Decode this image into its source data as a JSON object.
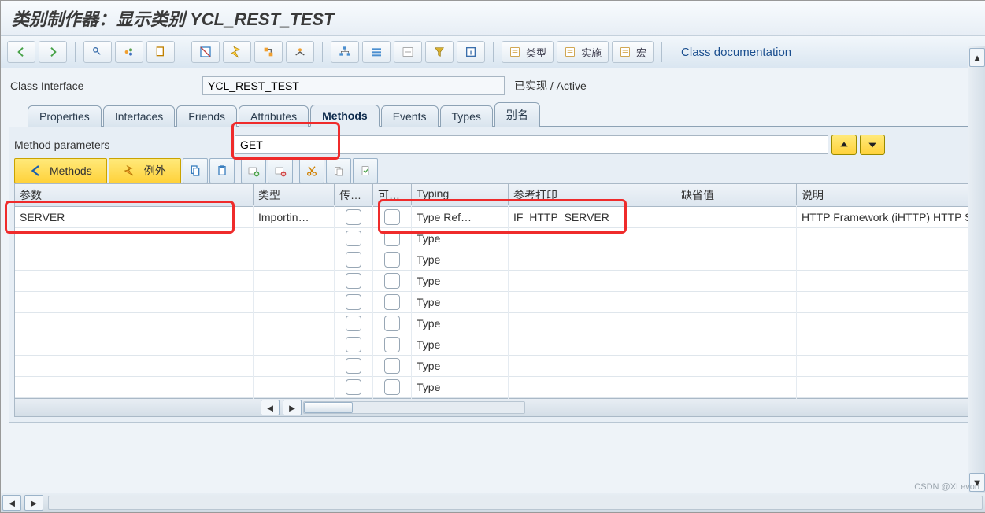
{
  "title_prefix": "类别制作器：显示类别 ",
  "title_class": "YCL_REST_TEST",
  "toolbar_text_buttons": {
    "types": "类型",
    "impl": "实施",
    "macro": "宏"
  },
  "class_doc_link": "Class documentation",
  "class_interface_label": "Class Interface",
  "class_interface_value": "YCL_REST_TEST",
  "status_text": "已实现 / Active",
  "tabs": [
    "Properties",
    "Interfaces",
    "Friends",
    "Attributes",
    "Methods",
    "Events",
    "Types",
    "别名"
  ],
  "active_tab_index": 4,
  "method_params_label": "Method parameters",
  "method_name": "GET",
  "btn_methods": "Methods",
  "btn_exceptions": "例外",
  "grid_headers": {
    "param": "参数",
    "kind": "类型",
    "pass": "传…",
    "opt": "可…",
    "typing": "Typing",
    "ref": "参考打印",
    "default": "缺省值",
    "desc": "说明"
  },
  "grid_rows": [
    {
      "param": "SERVER",
      "kind": "Importin…",
      "typing": "Type Ref…",
      "ref": "IF_HTTP_SERVER",
      "default": "",
      "desc": "HTTP Framework (iHTTP) HTTP Se"
    },
    {
      "param": "",
      "kind": "",
      "typing": "Type",
      "ref": "",
      "default": "",
      "desc": ""
    },
    {
      "param": "",
      "kind": "",
      "typing": "Type",
      "ref": "",
      "default": "",
      "desc": ""
    },
    {
      "param": "",
      "kind": "",
      "typing": "Type",
      "ref": "",
      "default": "",
      "desc": ""
    },
    {
      "param": "",
      "kind": "",
      "typing": "Type",
      "ref": "",
      "default": "",
      "desc": ""
    },
    {
      "param": "",
      "kind": "",
      "typing": "Type",
      "ref": "",
      "default": "",
      "desc": ""
    },
    {
      "param": "",
      "kind": "",
      "typing": "Type",
      "ref": "",
      "default": "",
      "desc": ""
    },
    {
      "param": "",
      "kind": "",
      "typing": "Type",
      "ref": "",
      "default": "",
      "desc": ""
    },
    {
      "param": "",
      "kind": "",
      "typing": "Type",
      "ref": "",
      "default": "",
      "desc": ""
    }
  ],
  "watermark": "CSDN @XLevon"
}
